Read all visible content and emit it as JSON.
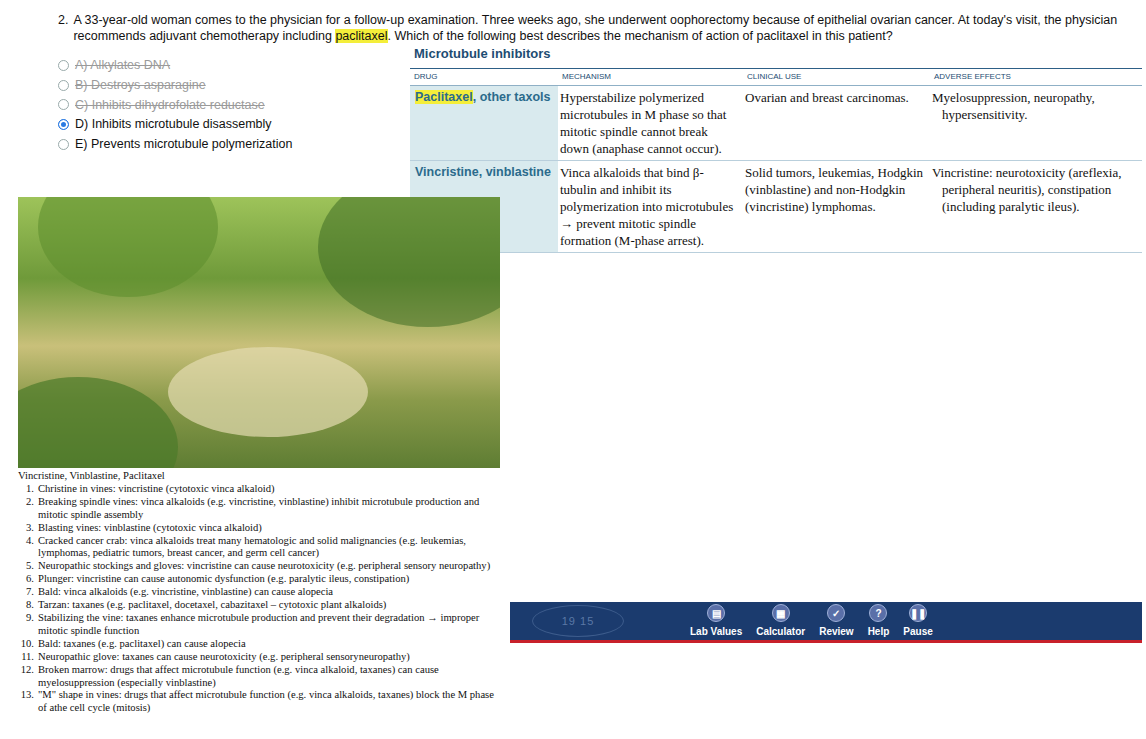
{
  "question": {
    "number": "2.",
    "before": "A 33-year-old woman comes to the physician for a follow-up examination. Three weeks ago, she underwent oophorectomy because of epithelial ovarian cancer. At today's visit, the physician recommends adjuvant chemotherapy including ",
    "highlight": "paclitaxel",
    "after": ". Which of the following best describes the mechanism of action of paclitaxel in this patient?"
  },
  "options": [
    {
      "text": "A) Alkylates DNA",
      "selected": false,
      "struck": true
    },
    {
      "text": "B) Destroys asparagine",
      "selected": false,
      "struck": true
    },
    {
      "text": "C) Inhibits dihydrofolate reductase",
      "selected": false,
      "struck": true
    },
    {
      "text": "D) Inhibits microtubule disassembly",
      "selected": true,
      "struck": false
    },
    {
      "text": "E) Prevents microtubule polymerization",
      "selected": false,
      "struck": false
    }
  ],
  "table": {
    "title": "Microtubule inhibitors",
    "columns": [
      "DRUG",
      "MECHANISM",
      "CLINICAL USE",
      "ADVERSE EFFECTS"
    ],
    "rows": [
      {
        "drug_highlight": "Paclitaxel",
        "drug": ", other taxols",
        "mechanism": "Hyperstabilize polymerized microtubules in M phase so that mitotic spindle cannot break down (anaphase cannot occur).",
        "use": "Ovarian and breast carcinomas.",
        "adverse": "Myelosuppression, neuropathy, hypersensitivity."
      },
      {
        "drug_highlight": "",
        "drug": "Vincristine, vinblastine",
        "mechanism": "Vinca alkaloids that bind β-tubulin and inhibit its polymerization into microtubules → prevent mitotic spindle formation (M-phase arrest).",
        "use": "Solid tumors, leukemias, Hodgkin (vinblastine) and non-Hodgkin (vincristine) lymphomas.",
        "adverse": "Vincristine: neurotoxicity (areflexia, peripheral neuritis), constipation (including paralytic ileus)."
      }
    ]
  },
  "caption": {
    "title": "Vincristine, Vinblastine, Paclitaxel",
    "items": [
      {
        "num": "1.",
        "text": "Christine in vines: vincristine (cytotoxic vinca alkaloid)"
      },
      {
        "num": "2.",
        "text": "Breaking spindle vines: vinca alkaloids (e.g. vincristine, vinblastine) inhibit microtubule production and mitotic spindle assembly"
      },
      {
        "num": "3.",
        "text": "Blasting vines: vinblastine (cytotoxic vinca alkaloid)"
      },
      {
        "num": "4.",
        "text": "Cracked cancer crab: vinca alkaloids treat many hematologic and solid malignancies (e.g. leukemias, lymphomas, pediatric tumors, breast cancer, and germ cell cancer)"
      },
      {
        "num": "5.",
        "text": "Neuropathic stockings and gloves: vincristine can cause neurotoxicity (e.g. peripheral sensory neuropathy)"
      },
      {
        "num": "6.",
        "text": "Plunger: vincristine can cause autonomic dysfunction (e.g. paralytic ileus, constipation)"
      },
      {
        "num": "7.",
        "text": "Bald: vinca alkaloids (e.g. vincristine, vinblastine) can cause alopecia"
      },
      {
        "num": "8.",
        "text": "Tarzan: taxanes (e.g. paclitaxel, docetaxel, cabazitaxel – cytotoxic plant alkaloids)"
      },
      {
        "num": "9.",
        "text": "Stabilizing the vine: taxanes enhance microtubule production and prevent their degradation → improper mitotic spindle function"
      },
      {
        "num": "10.",
        "text": "Bald: taxanes (e.g. paclitaxel) can cause alopecia"
      },
      {
        "num": "11.",
        "text": "Neuropathic glove: taxanes can cause neurotoxicity (e.g. peripheral sensoryneuropathy)"
      },
      {
        "num": "12.",
        "text": "Broken marrow: drugs that affect microtubule function (e.g. vinca alkaloid, taxanes) can cause myelosuppression (especially vinblastine)"
      },
      {
        "num": "13.",
        "text": "\"M\" shape in vines: drugs that affect microtubule function (e.g. vinca alkaloids, taxanes) block the M phase of athe cell cycle (mitosis)"
      }
    ]
  },
  "toolbar": {
    "logo": "19 15",
    "buttons": [
      {
        "label": "Lab Values",
        "glyph": "▤"
      },
      {
        "label": "Calculator",
        "glyph": "▦"
      },
      {
        "label": "Review",
        "glyph": "✓"
      },
      {
        "label": "Help",
        "glyph": "?"
      },
      {
        "label": "Pause",
        "glyph": "❚❚"
      }
    ]
  }
}
